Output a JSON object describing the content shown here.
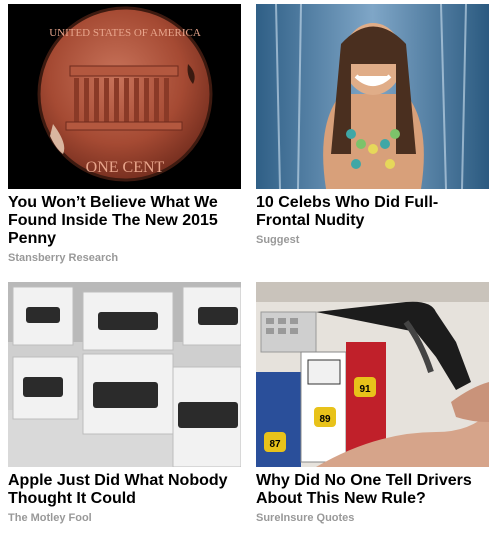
{
  "cards": [
    {
      "title": "You Won’t Believe What We Found Inside The New 2015 Penny",
      "source": "Stansberry Research",
      "image_icon": "penny-image"
    },
    {
      "title": "10 Celebs Who Did Full-Frontal Nudity",
      "source": "Suggest",
      "image_icon": "waterfall-woman-image"
    },
    {
      "title": "Apple Just Did What Nobody Thought It Could",
      "source": "The Motley Fool",
      "image_icon": "apple-tv-boxes-image"
    },
    {
      "title": "Why Did No One Tell Drivers About This New Rule?",
      "source": "SureInsure Quotes",
      "image_icon": "gas-pump-image"
    }
  ],
  "colors": {
    "title": "#000000",
    "source": "#999999",
    "background": "#ffffff"
  }
}
